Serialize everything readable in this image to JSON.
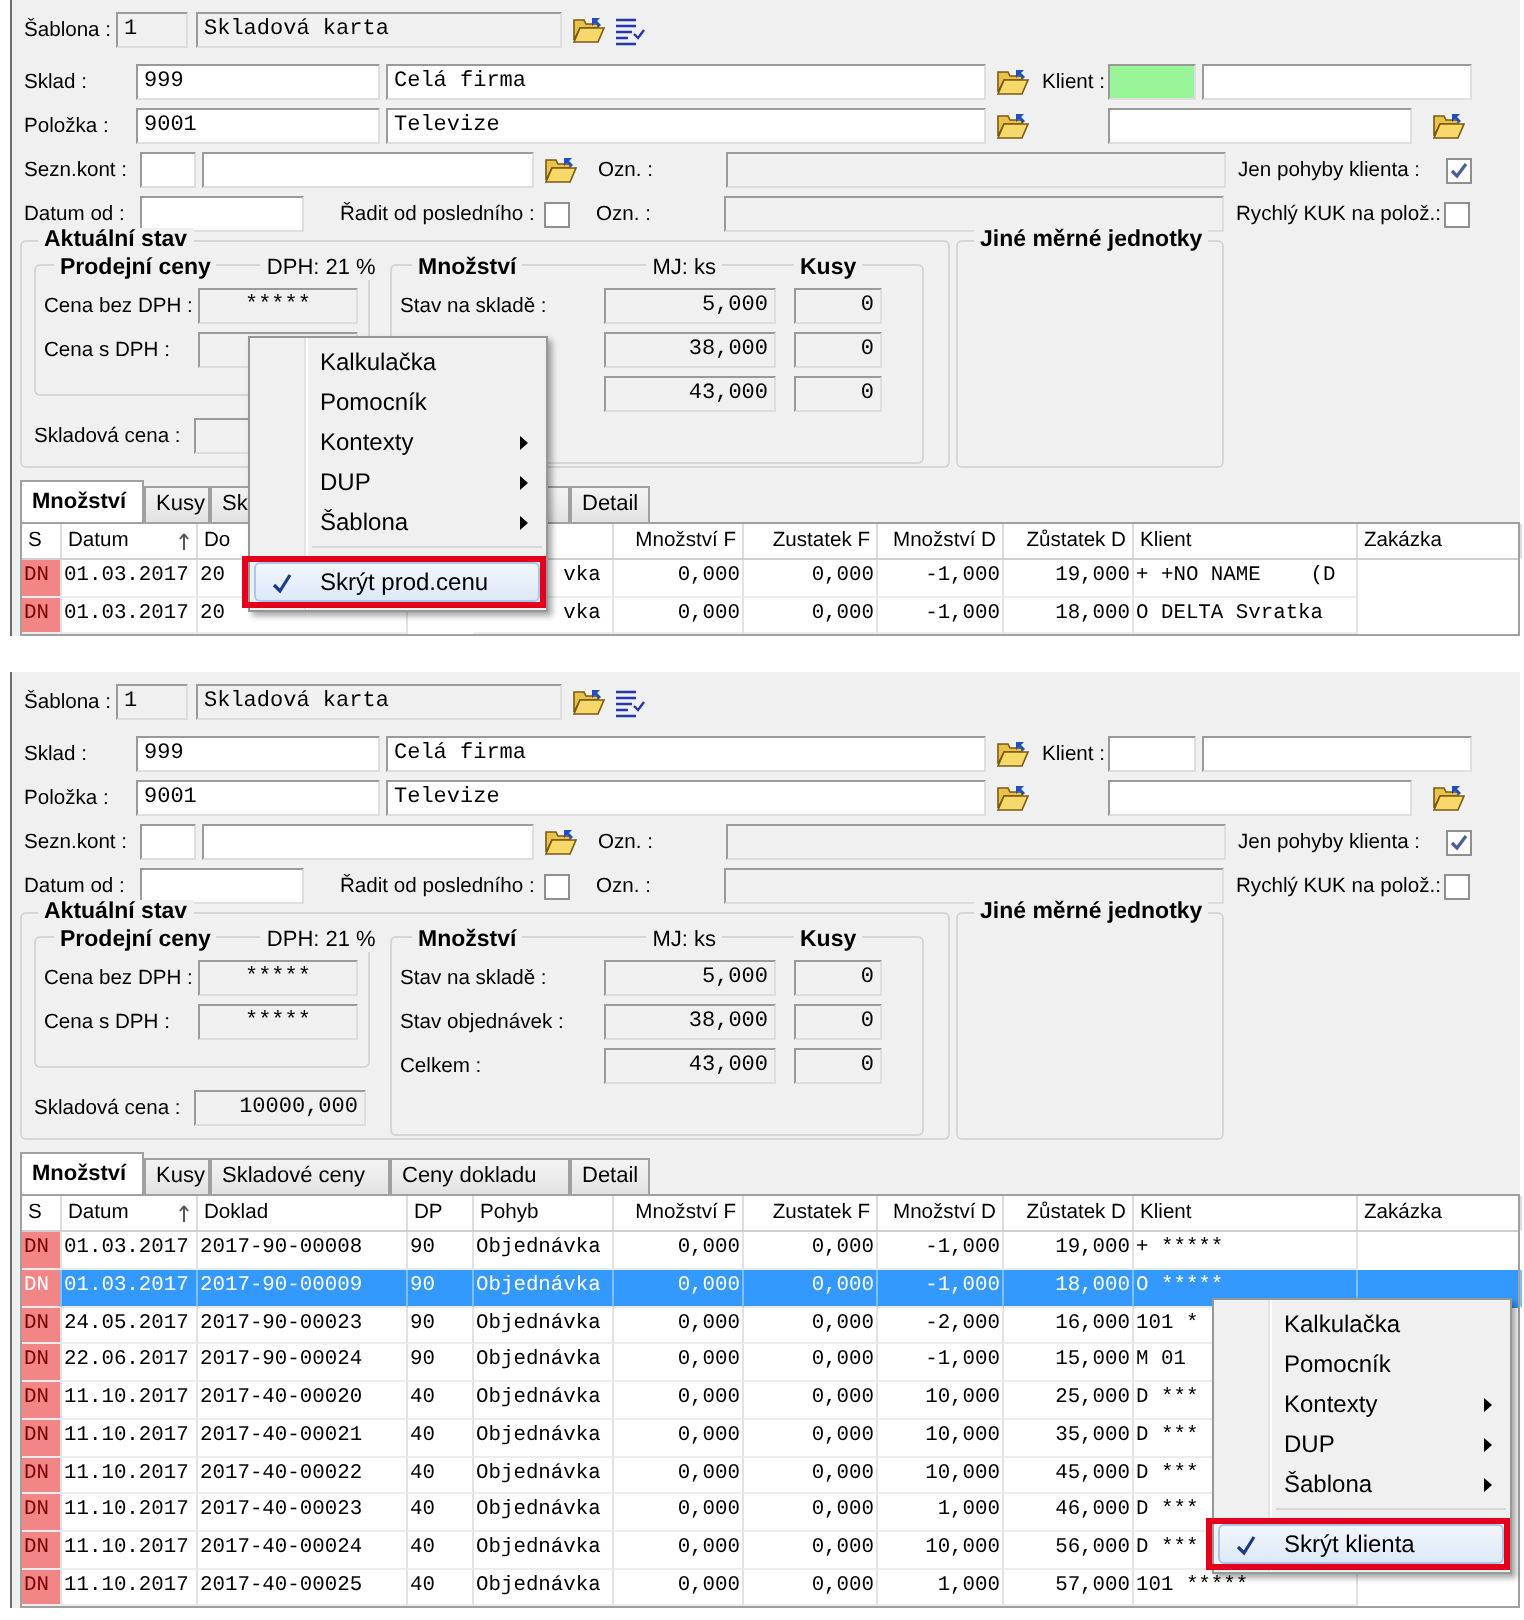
{
  "panels": [
    {
      "header": {
        "sablona": {
          "label": "Šablona :",
          "code": "1",
          "name": "Skladová karta"
        },
        "sklad": {
          "label": "Sklad :",
          "code": "999",
          "name": "Celá firma"
        },
        "klient": {
          "label": "Klient :",
          "highlighted": true
        },
        "polozka": {
          "label": "Položka :",
          "code": "9001",
          "name": "Televize"
        },
        "sezn_kont": {
          "label": "Sezn.kont :"
        },
        "ozn": [
          "Ozn. :",
          "Ozn. :"
        ],
        "datum_od": {
          "label": "Datum od :"
        },
        "radit": {
          "label": "Řadit od posledního :",
          "checked": false
        },
        "jen_pohyby": {
          "label": "Jen pohyby klienta :",
          "checked": true
        },
        "rychly_kuk": {
          "label": "Rychlý KUK na polož.:",
          "checked": false
        }
      },
      "current_state": {
        "title": "Aktuální stav",
        "prices": {
          "title": "Prodejní ceny",
          "vat": "DPH: 21 %",
          "rows": [
            {
              "label": "Cena bez DPH :",
              "value": "*****"
            },
            {
              "label": "Cena s DPH :"
            }
          ]
        },
        "stock_price": {
          "label": "Skladová cena :"
        },
        "quantity": {
          "title": "Množství",
          "unit": "MJ: ks",
          "pieces_title": "Kusy",
          "rows": [
            {
              "label": "Stav na skladě :",
              "value": "5,000",
              "pieces": "0"
            },
            {
              "value": "38,000",
              "pieces": "0"
            },
            {
              "value": "43,000",
              "pieces": "0"
            }
          ]
        }
      },
      "other_units": {
        "title": "Jiné měrné jednotky"
      },
      "tabs": [
        {
          "kind": "tab",
          "label": "Množství",
          "selected": true
        },
        {
          "kind": "tab",
          "label": "Kusy",
          "selected": false
        },
        {
          "kind": "tab",
          "label": "Sk",
          "selected": false
        },
        {
          "kind": "hidden"
        },
        {
          "kind": "tab",
          "label": "Detail",
          "selected": false
        }
      ],
      "table": {
        "columns": [
          {
            "label": "S",
            "sorted": false
          },
          {
            "label": "Datum",
            "sorted": true
          },
          {
            "label": "Do"
          },
          null,
          null,
          {
            "label": "Množství F",
            "sorted": false
          },
          {
            "label": "Zustatek F",
            "sorted": false
          },
          {
            "label": "Množství D",
            "sorted": false
          },
          {
            "label": "Zůstatek D",
            "sorted": false
          },
          {
            "label": "Klient",
            "sorted": false
          },
          {
            "label": "Zakázka",
            "sorted": false
          }
        ],
        "rows": [
          {
            "selected": false,
            "cells": [
              "DN",
              "01.03.2017",
              "20",
              null,
              "       vka",
              "0,000",
              "0,000",
              "-1,000",
              "19,000",
              "+ +NO NAME    (D",
              null
            ]
          },
          {
            "selected": false,
            "cells": [
              "DN",
              "01.03.2017",
              "20",
              null,
              "       vka",
              "0,000",
              "0,000",
              "-1,000",
              "18,000",
              "O DELTA Svratka",
              null
            ]
          }
        ]
      },
      "context_menu": {
        "items": [
          {
            "kind": "action",
            "label": "Kalkulačka"
          },
          {
            "kind": "action",
            "label": "Pomocník"
          },
          {
            "kind": "submenu",
            "label": "Kontexty"
          },
          {
            "kind": "submenu",
            "label": "DUP"
          },
          {
            "kind": "submenu",
            "label": "Šablona"
          },
          {
            "kind": "separator"
          },
          {
            "kind": "toggle",
            "label": "Skrýt prod.cenu",
            "checked": true,
            "framed": true
          }
        ]
      }
    },
    {
      "header": {
        "sablona": {
          "label": "Šablona :",
          "code": "1",
          "name": "Skladová karta"
        },
        "sklad": {
          "label": "Sklad :",
          "code": "999",
          "name": "Celá firma"
        },
        "klient": {
          "label": "Klient :",
          "highlighted": false
        },
        "polozka": {
          "label": "Položka :",
          "code": "9001",
          "name": "Televize"
        },
        "sezn_kont": {
          "label": "Sezn.kont :"
        },
        "ozn": [
          "Ozn. :",
          "Ozn. :"
        ],
        "datum_od": {
          "label": "Datum od :"
        },
        "radit": {
          "label": "Řadit od posledního :",
          "checked": false
        },
        "jen_pohyby": {
          "label": "Jen pohyby klienta :",
          "checked": true
        },
        "rychly_kuk": {
          "label": "Rychlý KUK na polož.:",
          "checked": false
        }
      },
      "current_state": {
        "title": "Aktuální stav",
        "prices": {
          "title": "Prodejní ceny",
          "vat": "DPH: 21 %",
          "rows": [
            {
              "label": "Cena bez DPH :",
              "value": "*****"
            },
            {
              "label": "Cena s DPH :",
              "value": "*****"
            }
          ]
        },
        "stock_price": {
          "label": "Skladová cena :",
          "value": "10000,000"
        },
        "quantity": {
          "title": "Množství",
          "unit": "MJ: ks",
          "pieces_title": "Kusy",
          "rows": [
            {
              "label": "Stav na skladě :",
              "value": "5,000",
              "pieces": "0"
            },
            {
              "label": "Stav objednávek :",
              "value": "38,000",
              "pieces": "0"
            },
            {
              "label": "Celkem :",
              "value": "43,000",
              "pieces": "0"
            }
          ]
        }
      },
      "other_units": {
        "title": "Jiné měrné jednotky"
      },
      "tabs": [
        {
          "kind": "tab",
          "label": "Množství",
          "selected": true
        },
        {
          "kind": "tab",
          "label": "Kusy",
          "selected": false
        },
        {
          "kind": "tab",
          "label": "Skladové ceny",
          "selected": false
        },
        {
          "kind": "tab",
          "label": "Ceny dokladu",
          "selected": false
        },
        {
          "kind": "tab",
          "label": "Detail",
          "selected": false
        }
      ],
      "table": {
        "columns": [
          {
            "label": "S",
            "sorted": false
          },
          {
            "label": "Datum",
            "sorted": true
          },
          {
            "label": "Doklad",
            "sorted": false
          },
          {
            "label": "DP",
            "sorted": false
          },
          {
            "label": "Pohyb",
            "sorted": false
          },
          {
            "label": "Množství F",
            "sorted": false
          },
          {
            "label": "Zustatek F",
            "sorted": false
          },
          {
            "label": "Množství D",
            "sorted": false
          },
          {
            "label": "Zůstatek D",
            "sorted": false
          },
          {
            "label": "Klient",
            "sorted": false
          },
          {
            "label": "Zakázka",
            "sorted": false
          }
        ],
        "rows": [
          {
            "selected": false,
            "cells": [
              "DN",
              "01.03.2017",
              "2017-90-00008",
              "90",
              "Objednávka",
              "0,000",
              "0,000",
              "-1,000",
              "19,000",
              "+ *****",
              null
            ]
          },
          {
            "selected": true,
            "cells": [
              "DN",
              "01.03.2017",
              "2017-90-00009",
              "90",
              "Objednávka",
              "0,000",
              "0,000",
              "-1,000",
              "18,000",
              "O *****",
              null
            ]
          },
          {
            "selected": false,
            "cells": [
              "DN",
              "24.05.2017",
              "2017-90-00023",
              "90",
              "Objednávka",
              "0,000",
              "0,000",
              "-2,000",
              "16,000",
              "101 *",
              null
            ]
          },
          {
            "selected": false,
            "cells": [
              "DN",
              "22.06.2017",
              "2017-90-00024",
              "90",
              "Objednávka",
              "0,000",
              "0,000",
              "-1,000",
              "15,000",
              "M 01",
              null
            ]
          },
          {
            "selected": false,
            "cells": [
              "DN",
              "11.10.2017",
              "2017-40-00020",
              "40",
              "Objednávka",
              "0,000",
              "0,000",
              "10,000",
              "25,000",
              "D ***",
              null
            ]
          },
          {
            "selected": false,
            "cells": [
              "DN",
              "11.10.2017",
              "2017-40-00021",
              "40",
              "Objednávka",
              "0,000",
              "0,000",
              "10,000",
              "35,000",
              "D ***",
              null
            ]
          },
          {
            "selected": false,
            "cells": [
              "DN",
              "11.10.2017",
              "2017-40-00022",
              "40",
              "Objednávka",
              "0,000",
              "0,000",
              "10,000",
              "45,000",
              "D ***",
              null
            ]
          },
          {
            "selected": false,
            "cells": [
              "DN",
              "11.10.2017",
              "2017-40-00023",
              "40",
              "Objednávka",
              "0,000",
              "0,000",
              "1,000",
              "46,000",
              "D ***",
              null
            ]
          },
          {
            "selected": false,
            "cells": [
              "DN",
              "11.10.2017",
              "2017-40-00024",
              "40",
              "Objednávka",
              "0,000",
              "0,000",
              "10,000",
              "56,000",
              "D ***",
              null
            ]
          },
          {
            "selected": false,
            "cells": [
              "DN",
              "11.10.2017",
              "2017-40-00025",
              "40",
              "Objednávka",
              "0,000",
              "0,000",
              "1,000",
              "57,000",
              "101 *****",
              null
            ]
          }
        ]
      },
      "context_menu": {
        "items": [
          {
            "kind": "action",
            "label": "Kalkulačka"
          },
          {
            "kind": "action",
            "label": "Pomocník"
          },
          {
            "kind": "submenu",
            "label": "Kontexty"
          },
          {
            "kind": "submenu",
            "label": "DUP"
          },
          {
            "kind": "submenu",
            "label": "Šablona"
          },
          {
            "kind": "separator"
          },
          {
            "kind": "toggle",
            "label": "Skrýt klienta",
            "checked": true,
            "framed": true
          }
        ]
      }
    }
  ]
}
